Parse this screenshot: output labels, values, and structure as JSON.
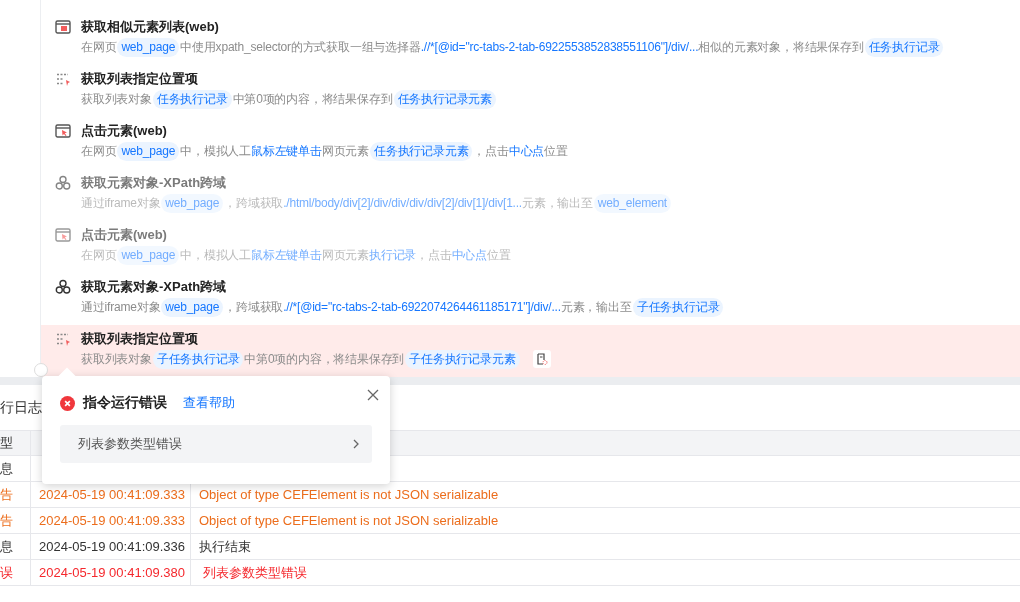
{
  "steps": [
    {
      "kind": "browser-list",
      "title": "获取相似元素列表(web)",
      "disabled": false,
      "selected": false,
      "log_button": false,
      "desc": [
        {
          "kind": "plain",
          "text": "在网页"
        },
        {
          "kind": "chip",
          "text": "web_page"
        },
        {
          "kind": "plain",
          "text": "中使用xpath_selector的方式获取一组与选择器"
        },
        {
          "kind": "link",
          "text": ".//*[@id=\"rc-tabs-2-tab-6922553852838551106\"]/div/..."
        },
        {
          "kind": "plain",
          "text": "相似的元素对象，将结果保存到"
        },
        {
          "kind": "chip",
          "text": "任务执行记录"
        }
      ]
    },
    {
      "kind": "list-pick",
      "title": "获取列表指定位置项",
      "disabled": false,
      "selected": false,
      "log_button": false,
      "desc": [
        {
          "kind": "plain",
          "text": "获取列表对象"
        },
        {
          "kind": "chip",
          "text": "任务执行记录"
        },
        {
          "kind": "plain",
          "text": "中第0项的内容，将结果保存到"
        },
        {
          "kind": "chip",
          "text": "任务执行记录元素"
        }
      ]
    },
    {
      "kind": "click",
      "title": "点击元素(web)",
      "disabled": false,
      "selected": false,
      "log_button": false,
      "desc": [
        {
          "kind": "plain",
          "text": "在网页"
        },
        {
          "kind": "chip",
          "text": "web_page"
        },
        {
          "kind": "plain",
          "text": "中，模拟人工"
        },
        {
          "kind": "link",
          "text": "鼠标左键单击"
        },
        {
          "kind": "plain",
          "text": "网页元素"
        },
        {
          "kind": "chip",
          "text": "任务执行记录元素"
        },
        {
          "kind": "plain",
          "text": "，点击"
        },
        {
          "kind": "link",
          "text": "中心点"
        },
        {
          "kind": "plain",
          "text": "位置"
        }
      ]
    },
    {
      "kind": "xpath",
      "title": "获取元素对象-XPath跨域",
      "disabled": true,
      "selected": false,
      "log_button": false,
      "desc": [
        {
          "kind": "plain",
          "text": "通过iframe对象"
        },
        {
          "kind": "chip",
          "text": "web_page"
        },
        {
          "kind": "plain",
          "text": "，跨域获取"
        },
        {
          "kind": "link",
          "text": "./html/body/div[2]/div/div/div/div[2]/div[1]/div[1..."
        },
        {
          "kind": "plain",
          "text": "元素，输出至"
        },
        {
          "kind": "chip",
          "text": "web_element"
        }
      ]
    },
    {
      "kind": "click",
      "title": "点击元素(web)",
      "disabled": true,
      "selected": false,
      "log_button": false,
      "desc": [
        {
          "kind": "plain",
          "text": "在网页"
        },
        {
          "kind": "chip",
          "text": "web_page"
        },
        {
          "kind": "plain",
          "text": "中，模拟人工"
        },
        {
          "kind": "link",
          "text": "鼠标左键单击"
        },
        {
          "kind": "plain",
          "text": "网页元素"
        },
        {
          "kind": "link",
          "text": "执行记录"
        },
        {
          "kind": "plain",
          "text": "，点击"
        },
        {
          "kind": "link",
          "text": "中心点"
        },
        {
          "kind": "plain",
          "text": "位置"
        }
      ]
    },
    {
      "kind": "xpath",
      "title": "获取元素对象-XPath跨域",
      "disabled": false,
      "selected": false,
      "log_button": false,
      "desc": [
        {
          "kind": "plain",
          "text": "通过iframe对象"
        },
        {
          "kind": "chip",
          "text": "web_page"
        },
        {
          "kind": "plain",
          "text": "，跨域获取"
        },
        {
          "kind": "link",
          "text": ".//*[@id=\"rc-tabs-2-tab-6922074264461185171\"]/div/..."
        },
        {
          "kind": "plain",
          "text": "元素，输出至"
        },
        {
          "kind": "chip",
          "text": "子任务执行记录"
        }
      ]
    },
    {
      "kind": "list-pick",
      "title": "获取列表指定位置项",
      "disabled": false,
      "selected": true,
      "log_button": true,
      "desc": [
        {
          "kind": "plain",
          "text": "获取列表对象"
        },
        {
          "kind": "chip",
          "text": "子任务执行记录"
        },
        {
          "kind": "plain",
          "text": "中第0项的内容，将结果保存到"
        },
        {
          "kind": "chip",
          "text": "子任务执行记录元素"
        }
      ]
    }
  ],
  "log_panel": {
    "title": "行日志",
    "columns": [
      "型"
    ],
    "rows": [
      {
        "kind": "info",
        "level": "息"
      },
      {
        "kind": "warning",
        "level": "告",
        "time": "2024-05-19 00:41:09.333",
        "message": "Object of type CEFElement is not JSON serializable"
      },
      {
        "kind": "warning",
        "level": "告",
        "time": "2024-05-19 00:41:09.333",
        "message": "Object of type CEFElement is not JSON serializable"
      },
      {
        "kind": "info",
        "level": "息",
        "time": "2024-05-19 00:41:09.336",
        "message": "执行结束"
      },
      {
        "kind": "error",
        "level": "误",
        "time": "2024-05-19 00:41:09.380",
        "message": "列表参数类型错误"
      }
    ]
  },
  "error_popup": {
    "title": "指令运行错误",
    "help_link": "查看帮助",
    "items": [
      {
        "text": "列表参数类型错误"
      }
    ]
  }
}
